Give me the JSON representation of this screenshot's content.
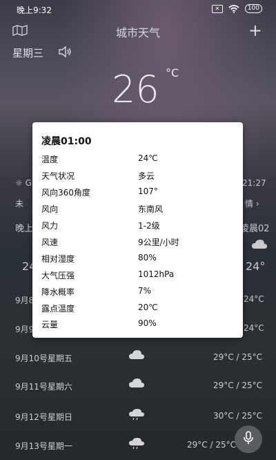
{
  "status": {
    "time": "晚上9:32",
    "battery": "100"
  },
  "header": {
    "title": "城市天气",
    "add": "+"
  },
  "today": {
    "weekday": "星期三",
    "temperature": "26",
    "unit": "°C"
  },
  "background": {
    "sunrise_prefix": "☼ G",
    "sunset_time": "21:27",
    "aqi_prefix": "未",
    "aqi_suffix": "情 ›",
    "hourly_left": "晚上",
    "hourly_right": "凌晨02",
    "temp_left": "24",
    "temp_right": "24°",
    "partial_dates": [
      {
        "date": "9月8",
        "temp": "24°C"
      },
      {
        "date": "9月9",
        "temp": "24°C"
      }
    ]
  },
  "daily": [
    {
      "date": "9月10号星期五",
      "range": "29°C / 25°C"
    },
    {
      "date": "9月11号星期六",
      "range": "29°C / 25°C"
    },
    {
      "date": "9月12号星期日",
      "range": "30°C / 25°C"
    },
    {
      "date": "9月13号星期一",
      "range": "29°C / 25°C"
    }
  ],
  "popup": {
    "title": "凌晨01:00",
    "rows": [
      {
        "label": "温度",
        "value": "24℃"
      },
      {
        "label": "天气状况",
        "value": "多云"
      },
      {
        "label": "风向360角度",
        "value": "107°"
      },
      {
        "label": "风向",
        "value": "东南风"
      },
      {
        "label": "风力",
        "value": "1-2级"
      },
      {
        "label": "风速",
        "value": "9公里/小时"
      },
      {
        "label": "相对湿度",
        "value": "80%"
      },
      {
        "label": "大气压强",
        "value": "1012hPa"
      },
      {
        "label": "降水概率",
        "value": "7%"
      },
      {
        "label": "露点温度",
        "value": "20℃"
      },
      {
        "label": "云量",
        "value": "90%"
      }
    ]
  },
  "icons": {
    "weather": "cloud-icon",
    "mic": "mic-icon"
  }
}
